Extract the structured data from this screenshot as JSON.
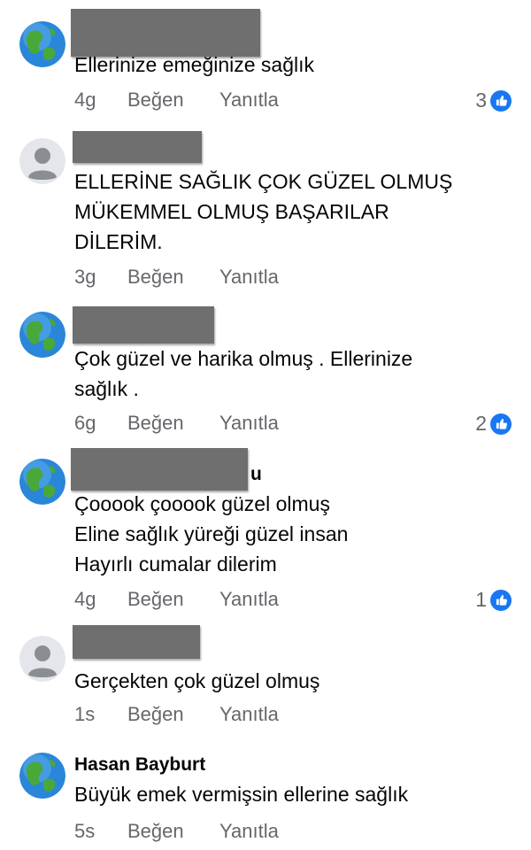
{
  "colors": {
    "accent": "#1877f2",
    "meta": "#65676b",
    "text": "#050505",
    "redaction": "#6f6f6f"
  },
  "comments": [
    {
      "author": "",
      "avatar": "globe-icon",
      "text": "Ellerinize emeğinize sağlık",
      "time": "4g",
      "like_label": "Beğen",
      "reply_label": "Yanıtla",
      "reactions": "3"
    },
    {
      "author": "",
      "avatar": "default-user-icon",
      "text": "ELLERİNE SAĞLIK ÇOK GÜZEL OLMUŞ\nMÜKEMMEL  OLMUŞ BAŞARILAR\nDİLERİM.",
      "time": "3g",
      "like_label": "Beğen",
      "reply_label": "Yanıtla",
      "reactions": ""
    },
    {
      "author": "",
      "avatar": "globe-icon",
      "text": "Çok güzel ve harika olmuş . Ellerinize\nsağlık .",
      "time": "6g",
      "like_label": "Beğen",
      "reply_label": "Yanıtla",
      "reactions": "2"
    },
    {
      "author_suffix": "u",
      "avatar": "globe-icon",
      "text": "Çooook çooook güzel olmuş\nEline sağlık yüreği güzel insan\nHayırlı cumalar dilerim",
      "time": "4g",
      "like_label": "Beğen",
      "reply_label": "Yanıtla",
      "reactions": "1"
    },
    {
      "author": "",
      "avatar": "default-user-icon",
      "text": "Gerçekten çok güzel olmuş",
      "time": "1s",
      "like_label": "Beğen",
      "reply_label": "Yanıtla",
      "reactions": ""
    },
    {
      "author": "Hasan Bayburt",
      "avatar": "globe-icon",
      "text": "Büyük emek vermişsin ellerine sağlık",
      "time": "5s",
      "like_label": "Beğen",
      "reply_label": "Yanıtla",
      "reactions": ""
    }
  ]
}
